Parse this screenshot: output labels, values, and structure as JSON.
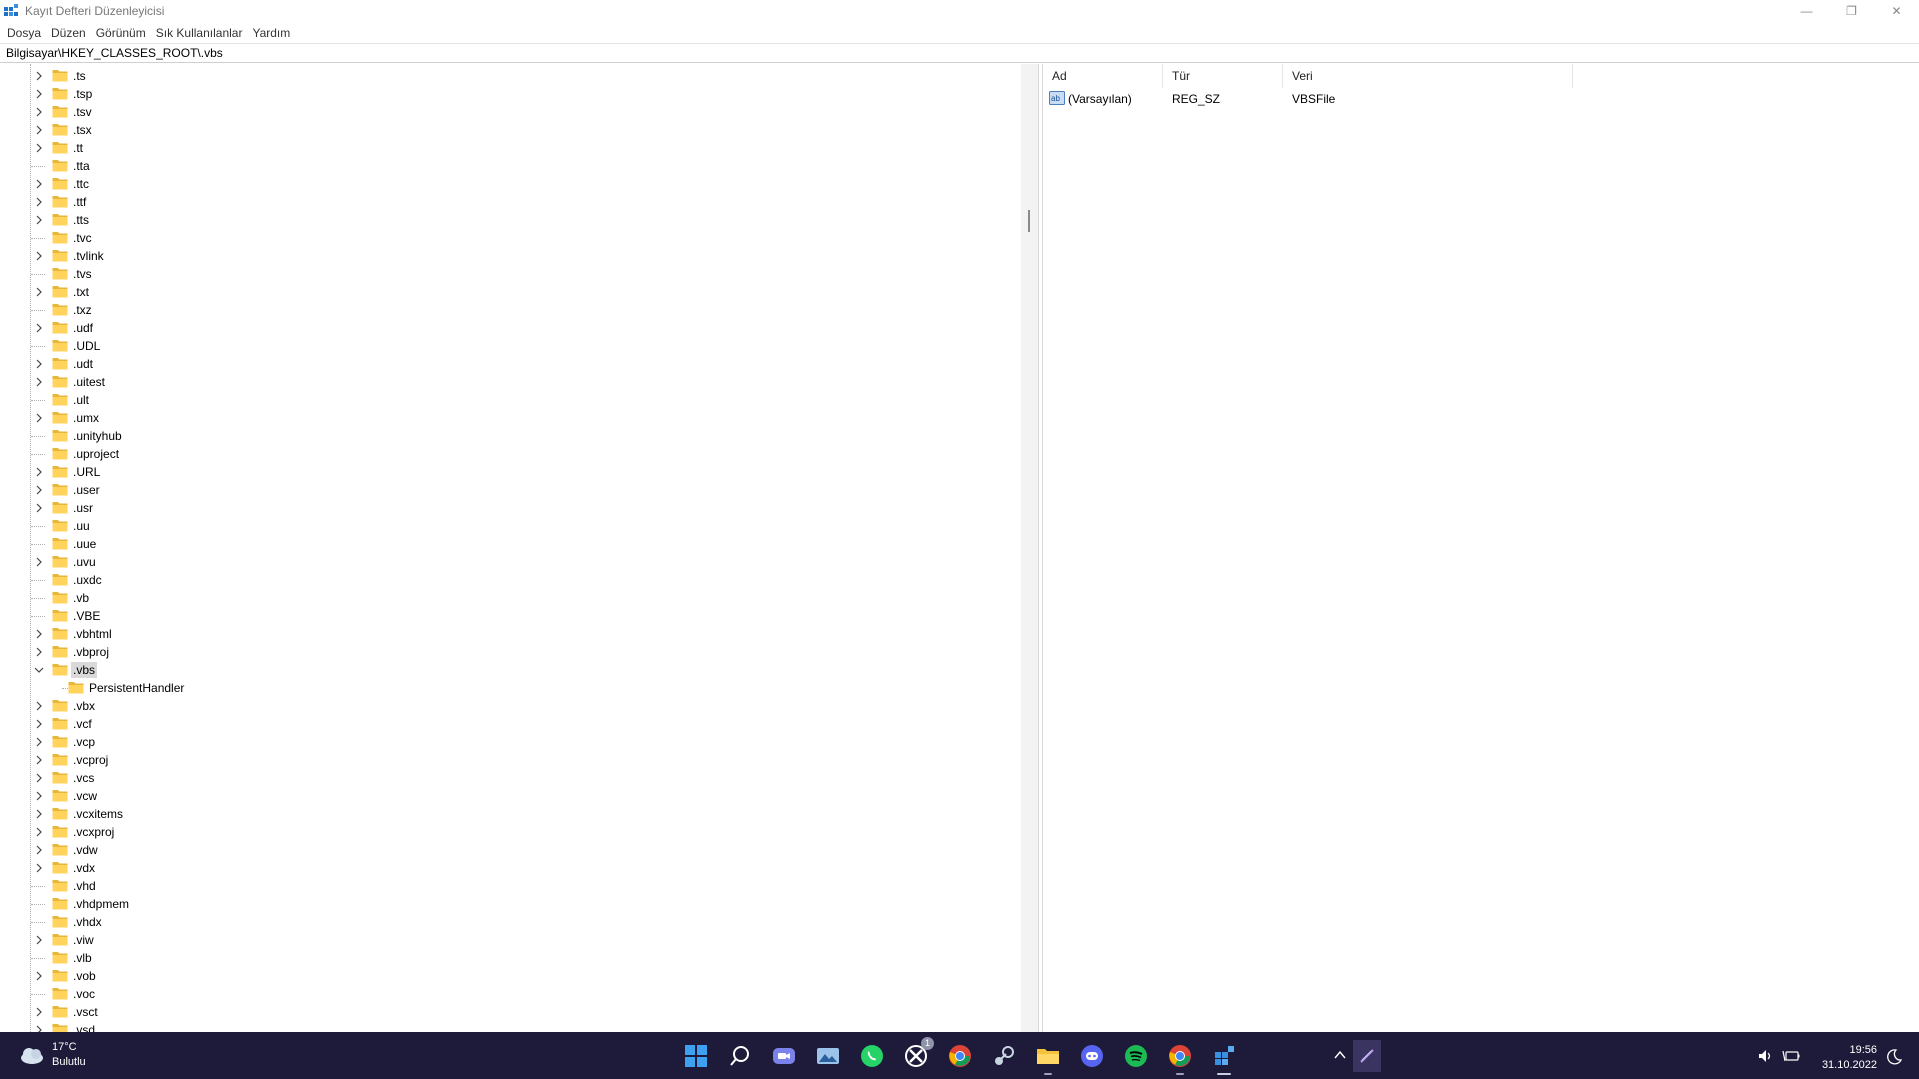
{
  "window": {
    "title": "Kayıt Defteri Düzenleyicisi",
    "controls": {
      "minimize": "—",
      "restore": "❐",
      "close": "✕"
    }
  },
  "menu": [
    "Dosya",
    "Düzen",
    "Görünüm",
    "Sık Kullanılanlar",
    "Yardım"
  ],
  "address": "Bilgisayar\\HKEY_CLASSES_ROOT\\.vbs",
  "tree": {
    "items": [
      {
        "label": ".ts",
        "expandable": true
      },
      {
        "label": ".tsp",
        "expandable": true
      },
      {
        "label": ".tsv",
        "expandable": true
      },
      {
        "label": ".tsx",
        "expandable": true
      },
      {
        "label": ".tt",
        "expandable": true
      },
      {
        "label": ".tta",
        "expandable": false
      },
      {
        "label": ".ttc",
        "expandable": true
      },
      {
        "label": ".ttf",
        "expandable": true
      },
      {
        "label": ".tts",
        "expandable": true
      },
      {
        "label": ".tvc",
        "expandable": false
      },
      {
        "label": ".tvlink",
        "expandable": true
      },
      {
        "label": ".tvs",
        "expandable": false
      },
      {
        "label": ".txt",
        "expandable": true
      },
      {
        "label": ".txz",
        "expandable": false
      },
      {
        "label": ".udf",
        "expandable": true
      },
      {
        "label": ".UDL",
        "expandable": false
      },
      {
        "label": ".udt",
        "expandable": true
      },
      {
        "label": ".uitest",
        "expandable": true
      },
      {
        "label": ".ult",
        "expandable": false
      },
      {
        "label": ".umx",
        "expandable": true
      },
      {
        "label": ".unityhub",
        "expandable": false
      },
      {
        "label": ".uproject",
        "expandable": false
      },
      {
        "label": ".URL",
        "expandable": true
      },
      {
        "label": ".user",
        "expandable": true
      },
      {
        "label": ".usr",
        "expandable": true
      },
      {
        "label": ".uu",
        "expandable": false
      },
      {
        "label": ".uue",
        "expandable": false
      },
      {
        "label": ".uvu",
        "expandable": true
      },
      {
        "label": ".uxdc",
        "expandable": false
      },
      {
        "label": ".vb",
        "expandable": false
      },
      {
        "label": ".VBE",
        "expandable": false
      },
      {
        "label": ".vbhtml",
        "expandable": true
      },
      {
        "label": ".vbproj",
        "expandable": true
      },
      {
        "label": ".vbs",
        "expandable": true,
        "expanded": true,
        "selected": true
      },
      {
        "label": "PersistentHandler",
        "expandable": false,
        "child": true
      },
      {
        "label": ".vbx",
        "expandable": true
      },
      {
        "label": ".vcf",
        "expandable": true
      },
      {
        "label": ".vcp",
        "expandable": true
      },
      {
        "label": ".vcproj",
        "expandable": true
      },
      {
        "label": ".vcs",
        "expandable": true
      },
      {
        "label": ".vcw",
        "expandable": true
      },
      {
        "label": ".vcxitems",
        "expandable": true
      },
      {
        "label": ".vcxproj",
        "expandable": true
      },
      {
        "label": ".vdw",
        "expandable": true
      },
      {
        "label": ".vdx",
        "expandable": true
      },
      {
        "label": ".vhd",
        "expandable": false
      },
      {
        "label": ".vhdpmem",
        "expandable": false
      },
      {
        "label": ".vhdx",
        "expandable": false
      },
      {
        "label": ".viw",
        "expandable": true
      },
      {
        "label": ".vlb",
        "expandable": false
      },
      {
        "label": ".vob",
        "expandable": true
      },
      {
        "label": ".voc",
        "expandable": false
      },
      {
        "label": ".vsct",
        "expandable": true
      },
      {
        "label": ".vsd",
        "expandable": true
      }
    ]
  },
  "values": {
    "columns": [
      "Ad",
      "Tür",
      "Veri"
    ],
    "rows": [
      {
        "name": "(Varsayılan)",
        "type": "REG_SZ",
        "data": "VBSFile",
        "icon": "string-value-icon"
      }
    ]
  },
  "taskbar": {
    "weather": {
      "temp": "17°C",
      "desc": "Bulutlu"
    },
    "apps": [
      "start",
      "search",
      "teams-chat",
      "photos",
      "whatsapp",
      "xbox",
      "chrome",
      "steam",
      "file-explorer",
      "discord",
      "spotify",
      "chrome-profile",
      "registry-editor"
    ],
    "xbox_badge": "1",
    "clock": {
      "time": "19:56",
      "date": "31.10.2022"
    },
    "colors": {
      "background": "#1e1b3a",
      "whatsapp": "#25d366",
      "spotify": "#1db954",
      "discord": "#5865f2",
      "start": "#3ea0f0"
    }
  }
}
